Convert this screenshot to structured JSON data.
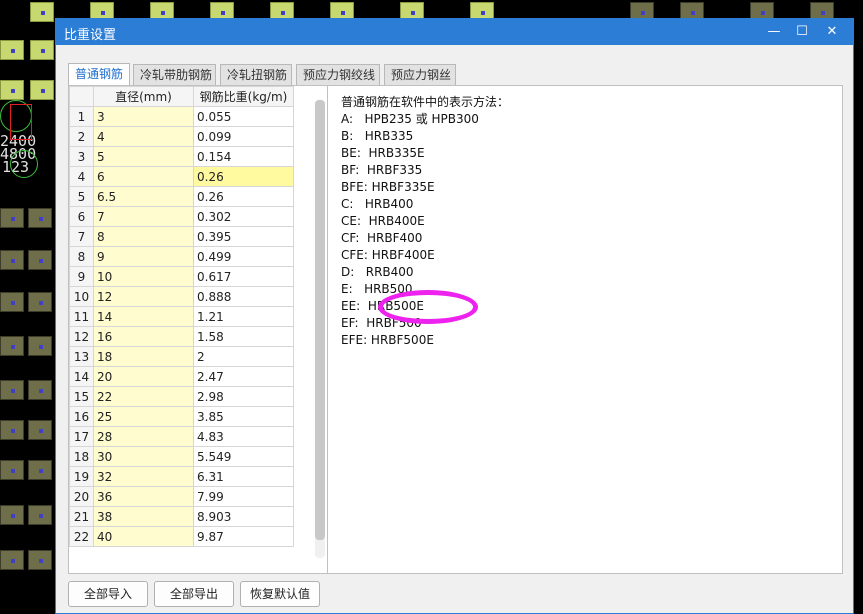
{
  "window": {
    "title": "比重设置",
    "min_glyph": "—",
    "max_glyph": "☐",
    "close_glyph": "✕"
  },
  "tabs": [
    {
      "label": "普通钢筋",
      "active": true
    },
    {
      "label": "冷轧带肋钢筋",
      "active": false
    },
    {
      "label": "冷轧扭钢筋",
      "active": false
    },
    {
      "label": "预应力钢绞线",
      "active": false
    },
    {
      "label": "预应力钢丝",
      "active": false
    }
  ],
  "table": {
    "headers": [
      "",
      "直径(mm)",
      "钢筋比重(kg/m)"
    ],
    "rows": [
      [
        "1",
        "3",
        "0.055"
      ],
      [
        "2",
        "4",
        "0.099"
      ],
      [
        "3",
        "5",
        "0.154"
      ],
      [
        "4",
        "6",
        "0.26"
      ],
      [
        "5",
        "6.5",
        "0.26"
      ],
      [
        "6",
        "7",
        "0.302"
      ],
      [
        "7",
        "8",
        "0.395"
      ],
      [
        "8",
        "9",
        "0.499"
      ],
      [
        "9",
        "10",
        "0.617"
      ],
      [
        "10",
        "12",
        "0.888"
      ],
      [
        "11",
        "14",
        "1.21"
      ],
      [
        "12",
        "16",
        "1.58"
      ],
      [
        "13",
        "18",
        "2"
      ],
      [
        "14",
        "20",
        "2.47"
      ],
      [
        "15",
        "22",
        "2.98"
      ],
      [
        "16",
        "25",
        "3.85"
      ],
      [
        "17",
        "28",
        "4.83"
      ],
      [
        "18",
        "30",
        "5.549"
      ],
      [
        "19",
        "32",
        "6.31"
      ],
      [
        "20",
        "36",
        "7.99"
      ],
      [
        "21",
        "38",
        "8.903"
      ],
      [
        "22",
        "40",
        "9.87"
      ]
    ],
    "selected_row": 4
  },
  "info": {
    "title": "普通钢筋在软件中的表示方法：",
    "lines": [
      "A:   HPB235 或 HPB300",
      "B:   HRB335",
      "BE:  HRB335E",
      "BF:  HRBF335",
      "BFE: HRBF335E",
      "C:   HRB400",
      "CE:  HRB400E",
      "CF:  HRBF400",
      "CFE: HRBF400E",
      "D:   RRB400",
      "E:   HRB500",
      "EE:  HRB500E",
      "EF:  HRBF500",
      "EFE: HRBF500E"
    ]
  },
  "buttons": {
    "import_all": "全部导入",
    "export_all": "全部导出",
    "restore_default": "恢复默认值"
  },
  "background": {
    "text_left_1": "2400",
    "text_left_2": "4800",
    "text_left_3": "123"
  },
  "colors": {
    "accent": "#2b7dd6",
    "highlight_circle": "#ee22ee",
    "diameter_cell_bg": "#fffcd0",
    "selected_cell_bg": "#fff9a0"
  }
}
